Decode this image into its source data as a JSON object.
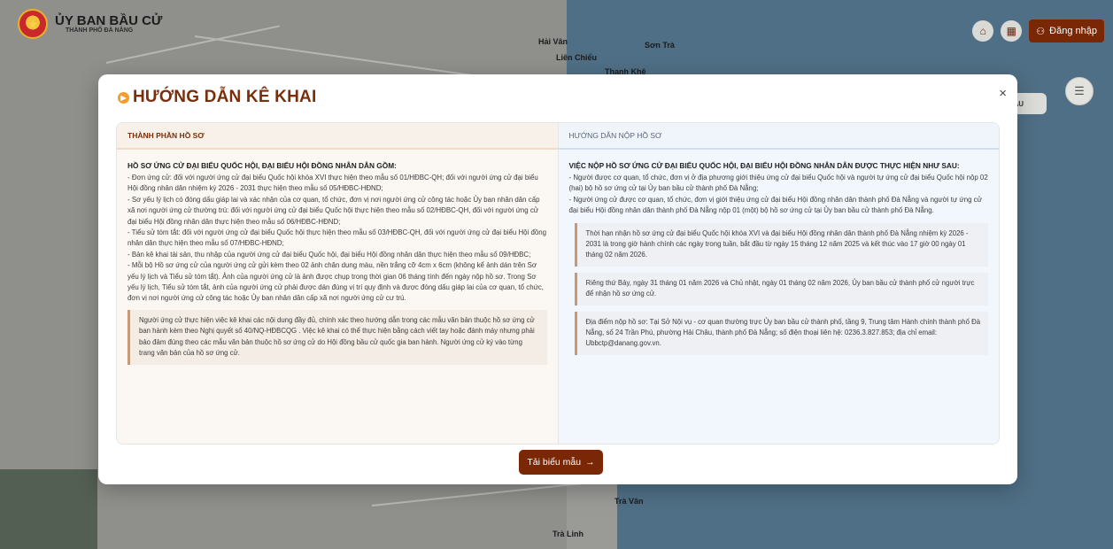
{
  "header": {
    "org_title": "ỦY BAN BẦU CỬ",
    "org_subtitle": "THÀNH PHỐ ĐÀ NẴNG",
    "home_icon": "home-icon",
    "grid_icon": "grid-icon",
    "login_label": "Đăng nhập",
    "side_label": "ẪU MẪU"
  },
  "map_labels": [
    "Hải Vân",
    "Liên Chiểu",
    "Sơn Trà",
    "Thanh Khê",
    "Trà Vân",
    "Trà Linh"
  ],
  "modal": {
    "title": "HƯỚNG DẪN KÊ KHAI",
    "close_symbol": "×",
    "left": {
      "header": "THÀNH PHẦN HỒ SƠ",
      "section_title": "HỒ SƠ ỨNG CỬ ĐẠI BIỂU QUỐC HỘI, ĐẠI BIỂU HỘI ĐỒNG NHÂN DÂN GỒM:",
      "items": [
        "- Đơn ứng cử: đối với người ứng cử đại biểu Quốc hội khóa XVI thực hiện theo mẫu số 01/HĐBC-QH; đối với người ứng cử đại biểu Hội đồng nhân dân nhiệm kỳ 2026 - 2031 thực hiện theo mẫu số 05/HĐBC-HĐND;",
        "- Sơ yếu lý lịch có đóng dấu giáp lai và xác nhận của cơ quan, tổ chức, đơn vị nơi người ứng cử công tác hoặc Ủy ban nhân dân cấp xã nơi người ứng cử thường trú: đối với người ứng cử đại biểu Quốc hội thực hiện theo mẫu số 02/HĐBC-QH, đối với người ứng cử đại biểu Hội đồng nhân dân thực hiện theo mẫu số 06/HĐBC-HĐND;",
        "- Tiểu sử tóm tắt: đối với người ứng cử đại biểu Quốc hội thực hiện theo mẫu số 03/HĐBC-QH, đối với người ứng cử đại biểu Hội đồng nhân dân thực hiện theo mẫu số 07/HĐBC-HĐND;",
        "- Bản kê khai tài sản, thu nhập của người ứng cử đại biểu Quốc hội, đại biểu Hội đồng nhân dân thực hiện theo mẫu số 09/HĐBC;",
        "- Mỗi bộ Hồ sơ ứng cử của người ứng cử gửi kèm theo 02 ảnh chân dung màu, nền trắng cỡ 4cm x 6cm (không kể ảnh dán trên Sơ yếu lý lịch và Tiểu sử tóm tắt). Ảnh của người ứng cử là ảnh được chụp trong thời gian 06 tháng tính đến ngày nộp hồ sơ. Trong Sơ yếu lý lịch, Tiểu sử tóm tắt, ảnh của người ứng cử phải được dán đúng vị trí quy định và được đóng dấu giáp lai của cơ quan, tổ chức, đơn vị nơi người ứng cử công tác hoặc Ủy ban nhân dân cấp xã nơi người ứng cử cư trú."
      ],
      "note": "Người ứng cử thực hiện việc kê khai các nội dung đầy đủ, chính xác theo hướng dẫn trong các mẫu văn bản thuộc hồ sơ ứng cử ban hành kèm theo Nghị quyết số 40/NQ-HĐBCQG . Việc kê khai có thể thực hiện bằng cách viết tay hoặc đánh máy nhưng phải bảo đảm đúng theo các mẫu văn bản thuộc hồ sơ ứng cử do Hội đồng bầu cử quốc gia ban hành. Người ứng cử ký vào từng trang văn bản của hồ sơ ứng cử."
    },
    "right": {
      "header": "HƯỚNG DẪN NỘP HỒ SƠ",
      "section_title": "VIỆC NỘP HỒ SƠ ỨNG CỬ ĐẠI BIỂU QUỐC HỘI, ĐẠI BIỂU HỘI ĐỒNG NHÂN DÂN ĐƯỢC THỰC HIỆN NHƯ SAU:",
      "items": [
        "- Người được cơ quan, tổ chức, đơn vị ở địa phương giới thiệu ứng cử đại biểu Quốc hội và người tự ứng cử đại biểu Quốc hội nộp 02 (hai) bộ hồ sơ ứng cử tại Ủy ban bầu cử thành phố Đà Nẵng;",
        "- Người ứng cử được cơ quan, tổ chức, đơn vị giới thiệu ứng cử đại biểu Hội đồng nhân dân thành phố Đà Nẵng và người tự ứng cử đại biểu Hội đồng nhân dân thành phố Đà Nẵng nộp 01 (một) bộ hồ sơ ứng cử tại Ủy ban bầu cử thành phố Đà Nẵng."
      ],
      "notes": [
        "Thời hạn nhận hồ sơ ứng cử đại biểu Quốc hội khóa XVI và đại biểu Hội đồng nhân dân thành phố Đà Nẵng nhiệm kỳ 2026 - 2031 là trong giờ hành chính các ngày trong tuần, bắt đầu từ ngày 15 tháng 12 năm 2025 và kết thúc vào 17 giờ 00 ngày 01 tháng 02 năm 2026.",
        "Riêng thứ Bảy, ngày 31 tháng 01 năm 2026 và Chủ nhật, ngày 01 tháng 02 năm 2026, Ủy ban bầu cử thành phố cử người trực để nhận hồ sơ ứng cử.",
        "Địa điểm nộp hồ sơ: Tại Sở Nội vụ - cơ quan thường trực Ủy ban bầu cử thành phố, tầng 9, Trung tâm Hành chính thành phố Đà Nẵng, số 24 Trần Phú, phường Hải Châu, thành phố Đà Nẵng; số điện thoại liên hệ: 0236.3.827.853; địa chỉ email: Ubbctp@danang.gov.vn."
      ]
    },
    "download_label": "Tải biểu mẫu",
    "download_arrow": "→"
  },
  "colors": {
    "brand": "#7a2705",
    "title": "#7a2e0a",
    "accent_icon": "#f59c2f"
  }
}
